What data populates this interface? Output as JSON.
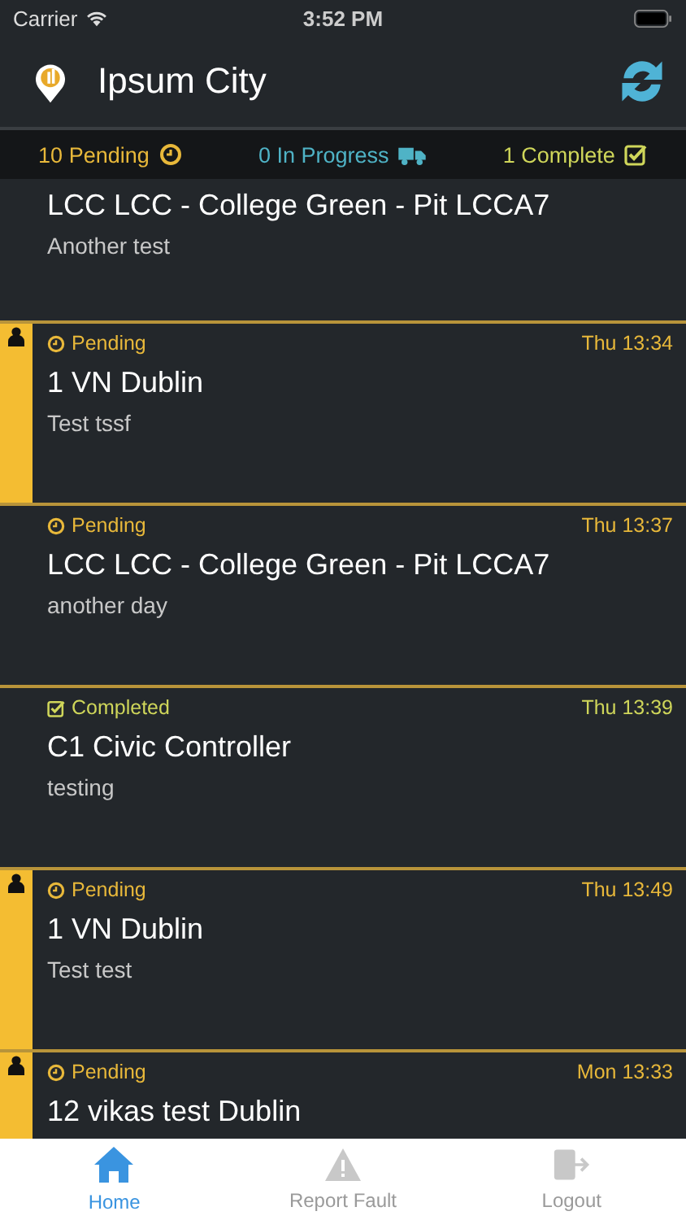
{
  "status_bar": {
    "carrier": "Carrier",
    "time": "3:52 PM"
  },
  "header": {
    "title": "Ipsum City"
  },
  "summary": [
    {
      "kind": "pending",
      "label": "10 Pending"
    },
    {
      "kind": "progress",
      "label": "0 In Progress"
    },
    {
      "kind": "complete",
      "label": "1 Complete"
    }
  ],
  "jobs": [
    {
      "title": "LCC LCC - College Green - Pit LCCA7",
      "description": "Another test",
      "assigned": false
    },
    {
      "kind": "pending",
      "status": "Pending",
      "time": "Thu 13:34",
      "title": "1 VN Dublin",
      "description": "Test tssf",
      "assigned": true
    },
    {
      "kind": "pending",
      "status": "Pending",
      "time": "Thu 13:37",
      "title": "LCC LCC - College Green - Pit LCCA7",
      "description": "another day",
      "assigned": false
    },
    {
      "kind": "completed",
      "status": "Completed",
      "time": "Thu 13:39",
      "title": "C1 Civic Controller",
      "description": "testing",
      "assigned": false
    },
    {
      "kind": "pending",
      "status": "Pending",
      "time": "Thu 13:49",
      "title": "1 VN Dublin",
      "description": "Test test",
      "assigned": true
    },
    {
      "kind": "pending",
      "status": "Pending",
      "time": "Mon 13:33",
      "title": "12 vikas test Dublin",
      "assigned": true
    }
  ],
  "tabs": [
    {
      "kind": "home",
      "label": "Home",
      "selected": true
    },
    {
      "kind": "fault",
      "label": "Report Fault",
      "selected": false
    },
    {
      "kind": "logout",
      "label": "Logout",
      "selected": false
    }
  ]
}
